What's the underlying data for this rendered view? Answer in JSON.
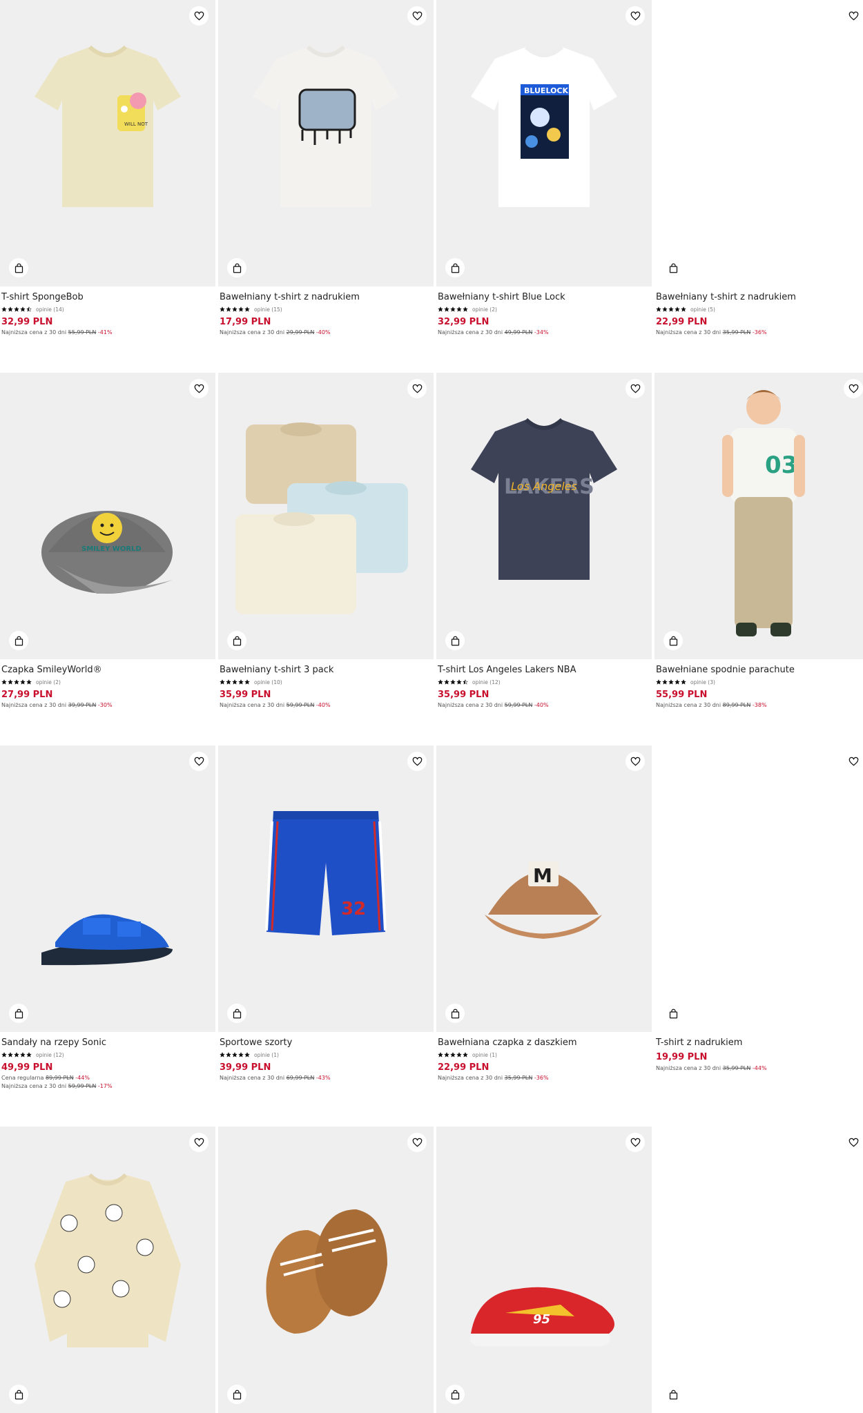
{
  "products": [
    {
      "name": "T-shirt SpongeBob",
      "stars": 4.5,
      "reviews": "opinie (14)",
      "price": "32,99 PLN",
      "lines": [
        {
          "label": "Najniższa cena z 30 dni",
          "old": "55,99 PLN",
          "discount": "-41%"
        }
      ],
      "image": "yellow-tshirt-spongebob"
    },
    {
      "name": "Bawełniany t-shirt z nadrukiem",
      "stars": 5,
      "reviews": "opinie (15)",
      "price": "17,99 PLN",
      "lines": [
        {
          "label": "Najniższa cena z 30 dni",
          "old": "29,99 PLN",
          "discount": "-40%"
        }
      ],
      "image": "white-tshirt-graffiti"
    },
    {
      "name": "Bawełniany t-shirt Blue Lock",
      "stars": 5,
      "reviews": "opinie (2)",
      "price": "32,99 PLN",
      "lines": [
        {
          "label": "Najniższa cena z 30 dni",
          "old": "49,99 PLN",
          "discount": "-34%"
        }
      ],
      "image": "white-tshirt-bluelock"
    },
    {
      "name": "Bawełniany t-shirt z nadrukiem",
      "stars": 5,
      "reviews": "opinie (5)",
      "price": "22,99 PLN",
      "lines": [
        {
          "label": "Najniższa cena z 30 dni",
          "old": "35,99 PLN",
          "discount": "-36%"
        }
      ],
      "image": "blank"
    },
    {
      "name": "Czapka SmileyWorld®",
      "stars": 5,
      "reviews": "opinie (2)",
      "price": "27,99 PLN",
      "lines": [
        {
          "label": "Najniższa cena z 30 dni",
          "old": "39,99 PLN",
          "discount": "-30%"
        }
      ],
      "image": "grey-cap-smiley"
    },
    {
      "name": "Bawełniany t-shirt 3 pack",
      "stars": 5,
      "reviews": "opinie (10)",
      "price": "35,99 PLN",
      "lines": [
        {
          "label": "Najniższa cena z 30 dni",
          "old": "59,99 PLN",
          "discount": "-40%"
        }
      ],
      "image": "tshirt-3-pack"
    },
    {
      "name": "T-shirt Los Angeles Lakers NBA",
      "stars": 4.5,
      "reviews": "opinie (12)",
      "price": "35,99 PLN",
      "lines": [
        {
          "label": "Najniższa cena z 30 dni",
          "old": "59,99 PLN",
          "discount": "-40%"
        }
      ],
      "image": "navy-tshirt-lakers"
    },
    {
      "name": "Bawełniane spodnie parachute",
      "stars": 5,
      "reviews": "opinie (3)",
      "price": "55,99 PLN",
      "lines": [
        {
          "label": "Najniższa cena z 30 dni",
          "old": "89,99 PLN",
          "discount": "-38%"
        }
      ],
      "image": "boy-beige-pants"
    },
    {
      "name": "Sandały na rzepy Sonic",
      "stars": 5,
      "reviews": "opinie (12)",
      "price": "49,99 PLN",
      "lines": [
        {
          "label": "Cena regularna",
          "old": "89,99 PLN",
          "discount": "-44%"
        },
        {
          "label": "Najniższa cena z 30 dni",
          "old": "59,99 PLN",
          "discount": "-17%"
        }
      ],
      "image": "blue-sandal"
    },
    {
      "name": "Sportowe szorty",
      "stars": 5,
      "reviews": "opinie (1)",
      "price": "39,99 PLN",
      "lines": [
        {
          "label": "Najniższa cena z 30 dni",
          "old": "69,99 PLN",
          "discount": "-43%"
        }
      ],
      "image": "blue-shorts-32"
    },
    {
      "name": "Bawełniana czapka z daszkiem",
      "stars": 5,
      "reviews": "opinie (1)",
      "price": "22,99 PLN",
      "lines": [
        {
          "label": "Najniższa cena z 30 dni",
          "old": "35,99 PLN",
          "discount": "-36%"
        }
      ],
      "image": "brown-cap-m"
    },
    {
      "name": "T-shirt z nadrukiem",
      "stars": 0,
      "reviews": "",
      "price": "19,99 PLN",
      "lines": [
        {
          "label": "Najniższa cena z 30 dni",
          "old": "35,99 PLN",
          "discount": "-44%"
        }
      ],
      "image": "blank"
    },
    {
      "name": "",
      "stars": 0,
      "reviews": "",
      "price": "",
      "lines": [],
      "image": "cream-sweatshirt-pochacco"
    },
    {
      "name": "",
      "stars": 0,
      "reviews": "",
      "price": "",
      "lines": [],
      "image": "brown-sneakers"
    },
    {
      "name": "",
      "stars": 0,
      "reviews": "",
      "price": "",
      "lines": [],
      "image": "red-sneaker-cars"
    },
    {
      "name": "",
      "stars": 0,
      "reviews": "",
      "price": "",
      "lines": [],
      "image": "blank"
    }
  ],
  "colors": {
    "price": "#c8102e",
    "image_bg": "#efefef"
  },
  "icons": {
    "favorite": "heart-icon",
    "add_to_cart": "shopping-bag-icon",
    "rating": "star-icon"
  }
}
